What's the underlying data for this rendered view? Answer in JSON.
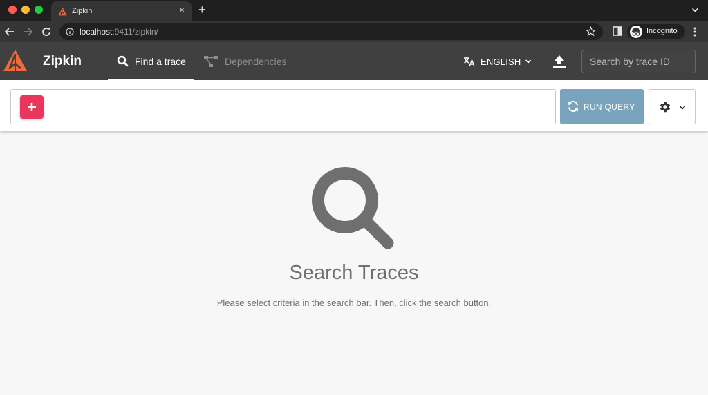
{
  "browser": {
    "tab_title": "Zipkin",
    "close_glyph": "×",
    "new_tab_glyph": "+",
    "url_host": "localhost",
    "url_rest": ":9411/zipkin/",
    "profile_label": "Incognito"
  },
  "header": {
    "brand": "Zipkin",
    "nav": [
      {
        "label": "Find a trace",
        "icon": "search-icon",
        "active": true
      },
      {
        "label": "Dependencies",
        "icon": "dependencies-icon",
        "active": false
      }
    ],
    "language": "ENGLISH",
    "trace_search_placeholder": "Search by trace ID"
  },
  "query": {
    "add_glyph": "+",
    "run_label": "RUN QUERY"
  },
  "empty_state": {
    "title": "Search Traces",
    "description": "Please select criteria in the search bar. Then, click the search button."
  },
  "colors": {
    "brand_orange": "#f06a3a",
    "add_button": "#e8365d",
    "run_button": "#7aa3bd",
    "header_bg": "#404040"
  }
}
